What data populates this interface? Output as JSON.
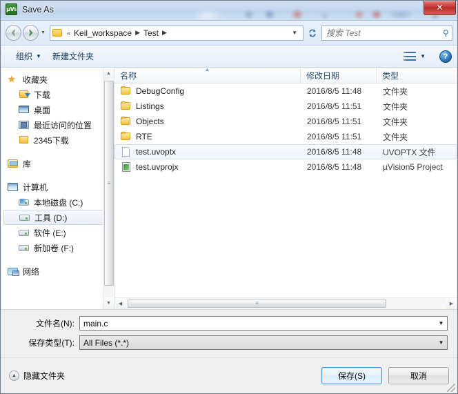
{
  "window": {
    "title": "Save As",
    "app_icon": "uvision5-icon",
    "close_label": "✕"
  },
  "nav": {
    "back_tooltip": "后退",
    "forward_tooltip": "前进",
    "recent_dropdown": "▼",
    "address": {
      "prefix": "«",
      "crumbs": [
        "Keil_workspace",
        "Test"
      ],
      "separator": "▶",
      "dropdown": "▼"
    },
    "refresh_icon": "↻",
    "search": {
      "placeholder": "搜索 Test",
      "value": "",
      "icon": "search-icon"
    }
  },
  "toolbar": {
    "organize_label": "组织",
    "organize_caret": "▼",
    "new_folder_label": "新建文件夹",
    "view_caret": "▼",
    "help_label": "?"
  },
  "sidebar": {
    "groups": [
      {
        "header": {
          "label": "收藏夹",
          "icon": "star-icon"
        },
        "items": [
          {
            "label": "下载",
            "icon": "download-folder-icon"
          },
          {
            "label": "桌面",
            "icon": "desktop-icon"
          },
          {
            "label": "最近访问的位置",
            "icon": "recent-places-icon"
          },
          {
            "label": "2345下载",
            "icon": "folder-icon"
          }
        ]
      },
      {
        "header": {
          "label": "库",
          "icon": "library-icon"
        },
        "items": []
      },
      {
        "header": {
          "label": "计算机",
          "icon": "computer-icon"
        },
        "items": [
          {
            "label": "本地磁盘 (C:)",
            "icon": "system-drive-icon",
            "selected": false
          },
          {
            "label": "工具 (D:)",
            "icon": "drive-icon",
            "selected": true
          },
          {
            "label": "软件 (E:)",
            "icon": "drive-icon",
            "selected": false
          },
          {
            "label": "新加卷 (F:)",
            "icon": "drive-icon",
            "selected": false
          }
        ]
      },
      {
        "header": {
          "label": "网络",
          "icon": "network-icon"
        },
        "items": []
      }
    ]
  },
  "filelist": {
    "columns": [
      "名称",
      "修改日期",
      "类型"
    ],
    "sort_column": "名称",
    "sort_direction": "asc",
    "rows": [
      {
        "name": "DebugConfig",
        "date": "2016/8/5 11:48",
        "type": "文件夹",
        "icon": "folder-icon",
        "highlighted": false
      },
      {
        "name": "Listings",
        "date": "2016/8/5 11:51",
        "type": "文件夹",
        "icon": "folder-icon",
        "highlighted": false
      },
      {
        "name": "Objects",
        "date": "2016/8/5 11:51",
        "type": "文件夹",
        "icon": "folder-icon",
        "highlighted": false
      },
      {
        "name": "RTE",
        "date": "2016/8/5 11:51",
        "type": "文件夹",
        "icon": "folder-icon",
        "highlighted": false
      },
      {
        "name": "test.uvoptx",
        "date": "2016/8/5 11:48",
        "type": "UVOPTX 文件",
        "icon": "document-icon",
        "highlighted": true
      },
      {
        "name": "test.uvprojx",
        "date": "2016/8/5 11:48",
        "type": "µVision5 Project",
        "icon": "project-icon",
        "highlighted": false
      }
    ]
  },
  "form": {
    "filename_label": "文件名(N):",
    "filename_value": "main.c",
    "filetype_label": "保存类型(T):",
    "filetype_value": "All Files (*.*)",
    "dropdown_caret": "▼"
  },
  "footer": {
    "hide_folders_label": "隐藏文件夹",
    "collapse_icon": "▲",
    "save_label": "保存(S)",
    "cancel_label": "取消"
  },
  "scrollbars": {
    "up_arrow": "▲",
    "down_arrow": "▼",
    "left_arrow": "◀",
    "right_arrow": "▶",
    "grip": "≡"
  }
}
